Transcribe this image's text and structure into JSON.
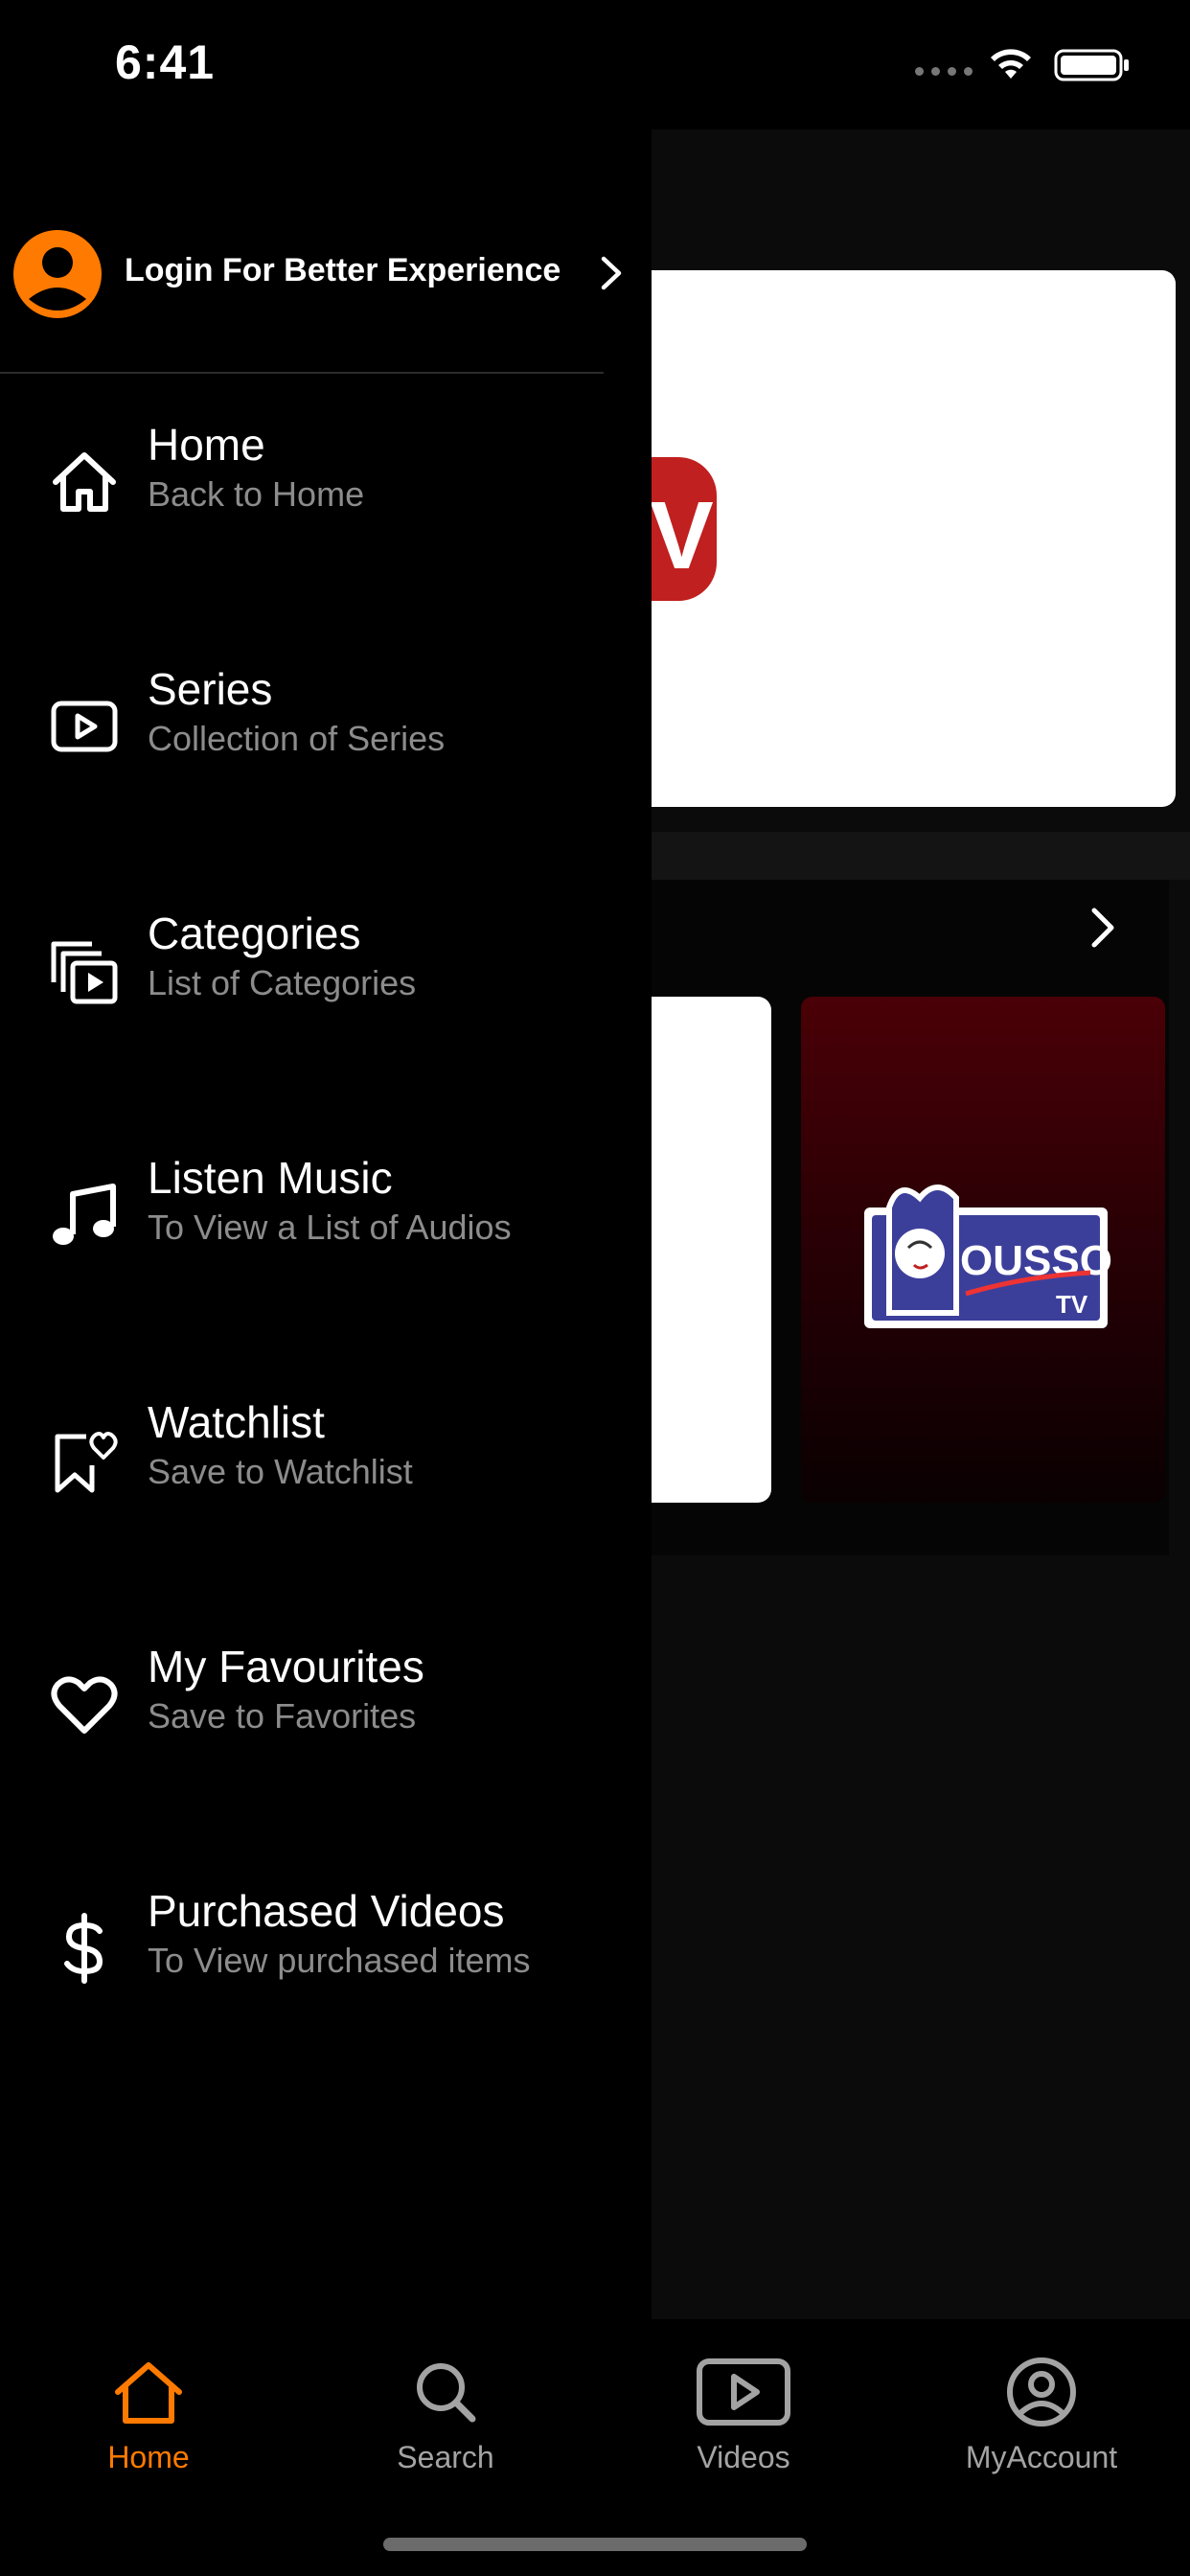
{
  "status_bar": {
    "time": "6:41"
  },
  "drawer": {
    "login_text": "Login For Better Experience",
    "menu": [
      {
        "title": "Home",
        "subtitle": "Back to Home",
        "icon": "home-icon"
      },
      {
        "title": "Series",
        "subtitle": "Collection of Series",
        "icon": "play-rectangle-icon"
      },
      {
        "title": "Categories",
        "subtitle": "List of Categories",
        "icon": "stacked-play-icon"
      },
      {
        "title": "Listen Music",
        "subtitle": "To View a List of Audios",
        "icon": "music-note-icon"
      },
      {
        "title": "Watchlist",
        "subtitle": "Save to Watchlist",
        "icon": "bookmark-heart-icon"
      },
      {
        "title": "My Favourites",
        "subtitle": "Save to Favorites",
        "icon": "heart-icon"
      },
      {
        "title": "Purchased Videos",
        "subtitle": "To View purchased items",
        "icon": "dollar-icon"
      }
    ]
  },
  "background": {
    "card_logo_text": "OUSSO",
    "card_logo_sub": "TV"
  },
  "bottom_nav": {
    "items": [
      {
        "label": "Home",
        "icon": "home-icon",
        "active": true
      },
      {
        "label": "Search",
        "icon": "search-icon",
        "active": false
      },
      {
        "label": "Videos",
        "icon": "play-rectangle-icon",
        "active": false
      },
      {
        "label": "MyAccount",
        "icon": "account-circle-icon",
        "active": false
      }
    ]
  },
  "colors": {
    "accent": "#ff7a00",
    "background": "#000000",
    "subtitle": "#8c8c8c",
    "nav_inactive": "#a3a3a3"
  }
}
